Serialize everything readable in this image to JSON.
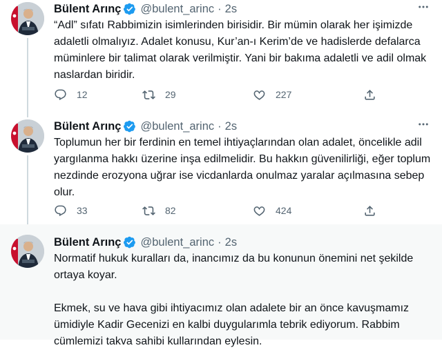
{
  "tweets": [
    {
      "name": "Bülent Arınç",
      "handle": "@bulent_arinc",
      "dot": "·",
      "time": "2s",
      "paragraphs": [
        "“Adl” sıfatı Rabbimizin isimlerinden birisidir. Bir mümin olarak her işimizde adaletli olmalıyız. Adalet konusu, Kur’an-ı Kerim’de ve hadislerde defalarca müminlere bir talimat olarak verilmiştir. Yani bir bakıma adaletli ve adil olmak naslardan biridir."
      ],
      "replies": "12",
      "retweets": "29",
      "likes": "227"
    },
    {
      "name": "Bülent Arınç",
      "handle": "@bulent_arinc",
      "dot": "·",
      "time": "2s",
      "paragraphs": [
        "Toplumun her bir ferdinin en temel ihtiyaçlarından olan adalet, öncelikle adil yargılanma hakkı üzerine inşa edilmelidir. Bu hakkın güvenilirliği, eğer toplum nezdinde erozyona uğrar ise vicdanlarda onulmaz yaralar açılmasına sebep olur."
      ],
      "replies": "33",
      "retweets": "82",
      "likes": "424"
    },
    {
      "name": "Bülent Arınç",
      "handle": "@bulent_arinc",
      "dot": "·",
      "time": "2s",
      "paragraphs": [
        "Normatif hukuk kuralları da, inancımız da bu konunun önemini net şekilde ortaya koyar.",
        "Ekmek, su ve hava gibi ihtiyacımız olan adalete bir an önce kavuşmamız ümidiyle Kadir Gecenizi en kalbi duygularımla tebrik ediyorum. Rabbim cümlemizi takva sahibi kullarından eylesin."
      ]
    }
  ],
  "icons": {
    "verified": "verified-badge-icon",
    "more": "more-options-icon",
    "reply": "reply-icon",
    "retweet": "retweet-icon",
    "like": "like-icon",
    "share": "share-icon"
  },
  "colors": {
    "accent": "#1d9bf0",
    "secondary_text": "#536471",
    "text": "#0f1419",
    "thread_line": "#cfd9de",
    "highlight_bg": "#f7f9f9"
  }
}
